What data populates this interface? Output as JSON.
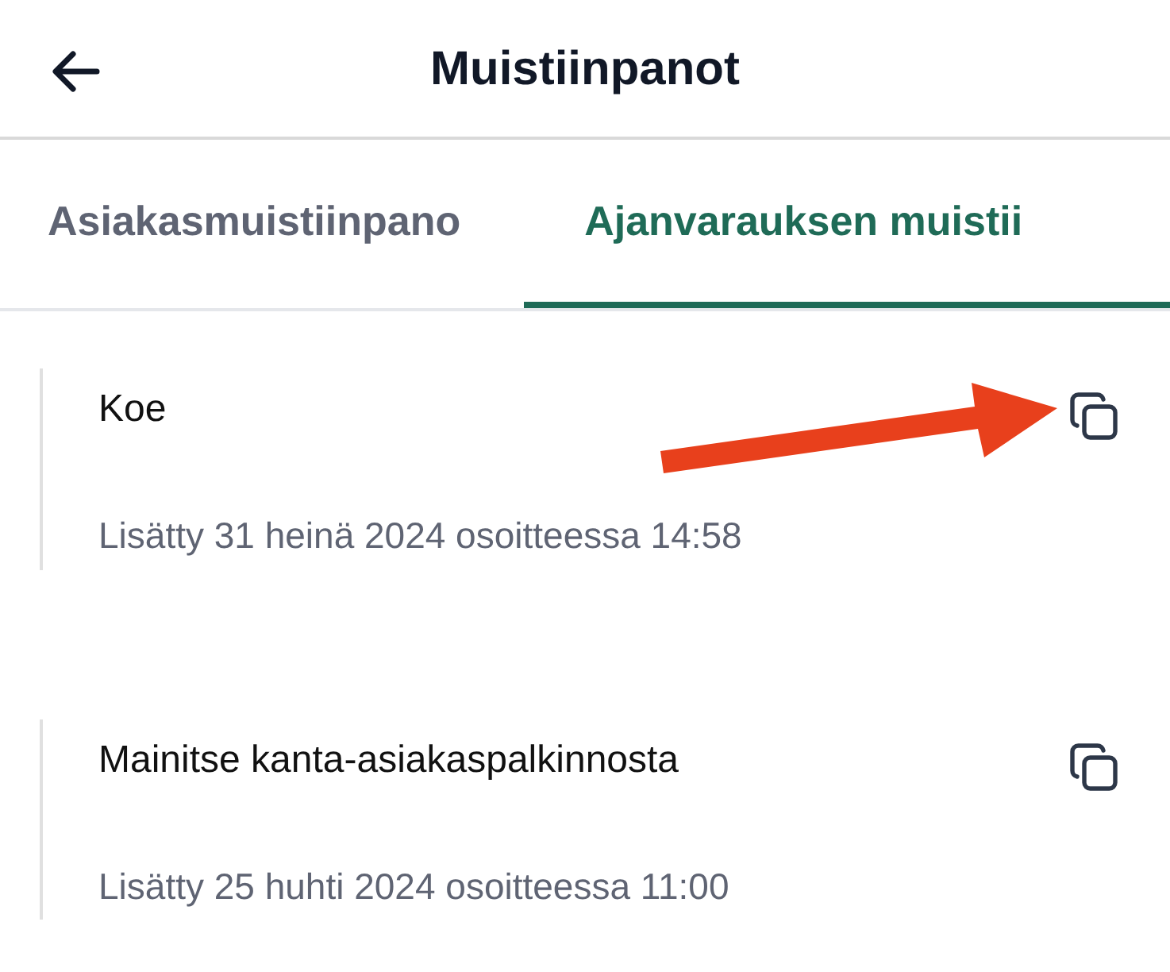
{
  "header": {
    "title": "Muistiinpanot"
  },
  "tabs": [
    {
      "label": "Asiakasmuistiinpano",
      "selected": false
    },
    {
      "label": "Ajanvarauksen muistii",
      "selected": true
    }
  ],
  "notes": [
    {
      "text": "Koe",
      "meta": "Lisätty 31 heinä 2024 osoitteessa 14:58"
    },
    {
      "text": "Mainitse kanta-asiakaspalkinnosta",
      "meta": "Lisätty 25 huhti 2024 osoitteessa 11:00"
    }
  ]
}
